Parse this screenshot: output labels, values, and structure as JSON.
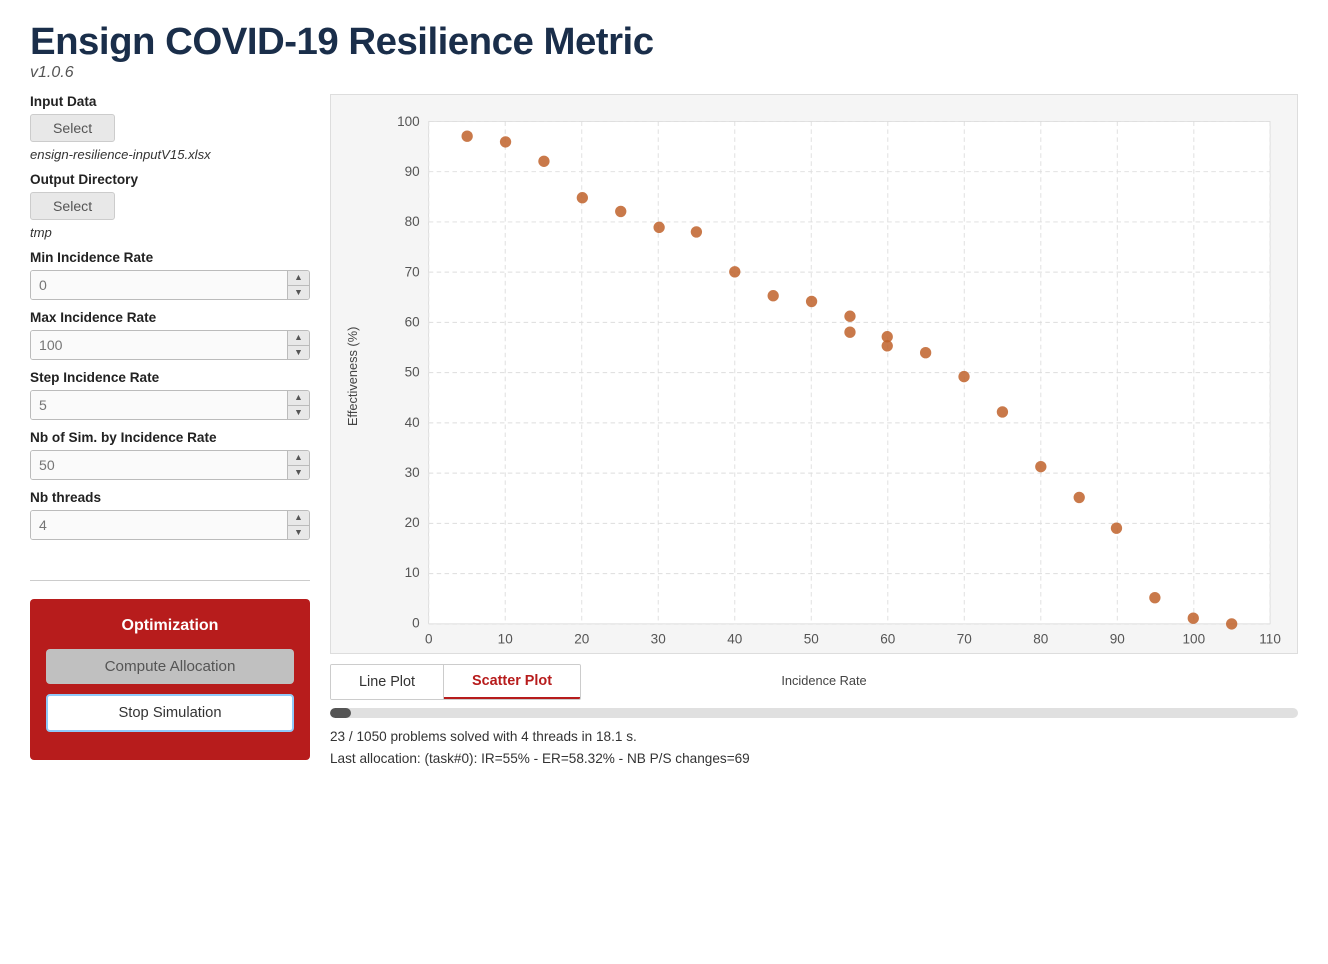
{
  "app": {
    "title": "Ensign COVID-19 Resilience Metric",
    "version": "v1.0.6"
  },
  "sidebar": {
    "input_data_label": "Input Data",
    "select_input_label": "Select",
    "input_file": "ensign-resilience-inputV15.xlsx",
    "output_dir_label": "Output Directory",
    "select_output_label": "Select",
    "output_dir": "tmp",
    "fields": [
      {
        "label": "Min Incidence Rate",
        "value": "0",
        "placeholder": "0"
      },
      {
        "label": "Max Incidence Rate",
        "value": "100",
        "placeholder": "100"
      },
      {
        "label": "Step Incidence Rate",
        "value": "5",
        "placeholder": "5"
      },
      {
        "label": "Nb of Sim. by Incidence Rate",
        "value": "50",
        "placeholder": "50"
      },
      {
        "label": "Nb threads",
        "value": "4",
        "placeholder": "4"
      }
    ]
  },
  "optimization": {
    "title": "Optimization",
    "compute_label": "Compute Allocation",
    "stop_label": "Stop Simulation"
  },
  "tabs": [
    {
      "label": "Line Plot",
      "active": false
    },
    {
      "label": "Scatter Plot",
      "active": true
    }
  ],
  "progress": {
    "percent": 2.2,
    "status_line1": "23 / 1050 problems solved with 4 threads in 18.1 s.",
    "status_line2": "Last allocation: (task#0): IR=55% - ER=58.32%  - NB P/S changes=69"
  },
  "chart": {
    "x_label": "Incidence Rate",
    "y_label": "Effectiveness (%)",
    "x_ticks": [
      0,
      10,
      20,
      30,
      40,
      50,
      60,
      70,
      80,
      90,
      100,
      110
    ],
    "y_ticks": [
      0,
      10,
      20,
      30,
      40,
      50,
      60,
      70,
      80,
      90,
      100
    ],
    "points": [
      {
        "x": 5,
        "y": 97
      },
      {
        "x": 10,
        "y": 96
      },
      {
        "x": 15,
        "y": 92
      },
      {
        "x": 20,
        "y": 85
      },
      {
        "x": 25,
        "y": 82
      },
      {
        "x": 30,
        "y": 79
      },
      {
        "x": 35,
        "y": 78
      },
      {
        "x": 40,
        "y": 70
      },
      {
        "x": 45,
        "y": 65
      },
      {
        "x": 50,
        "y": 64
      },
      {
        "x": 55,
        "y": 61
      },
      {
        "x": 55,
        "y": 58
      },
      {
        "x": 60,
        "y": 57
      },
      {
        "x": 60,
        "y": 55
      },
      {
        "x": 65,
        "y": 54
      },
      {
        "x": 70,
        "y": 49
      },
      {
        "x": 75,
        "y": 42
      },
      {
        "x": 80,
        "y": 31
      },
      {
        "x": 85,
        "y": 25
      },
      {
        "x": 90,
        "y": 19
      },
      {
        "x": 95,
        "y": 5
      },
      {
        "x": 100,
        "y": 1
      },
      {
        "x": 105,
        "y": 0
      }
    ]
  }
}
